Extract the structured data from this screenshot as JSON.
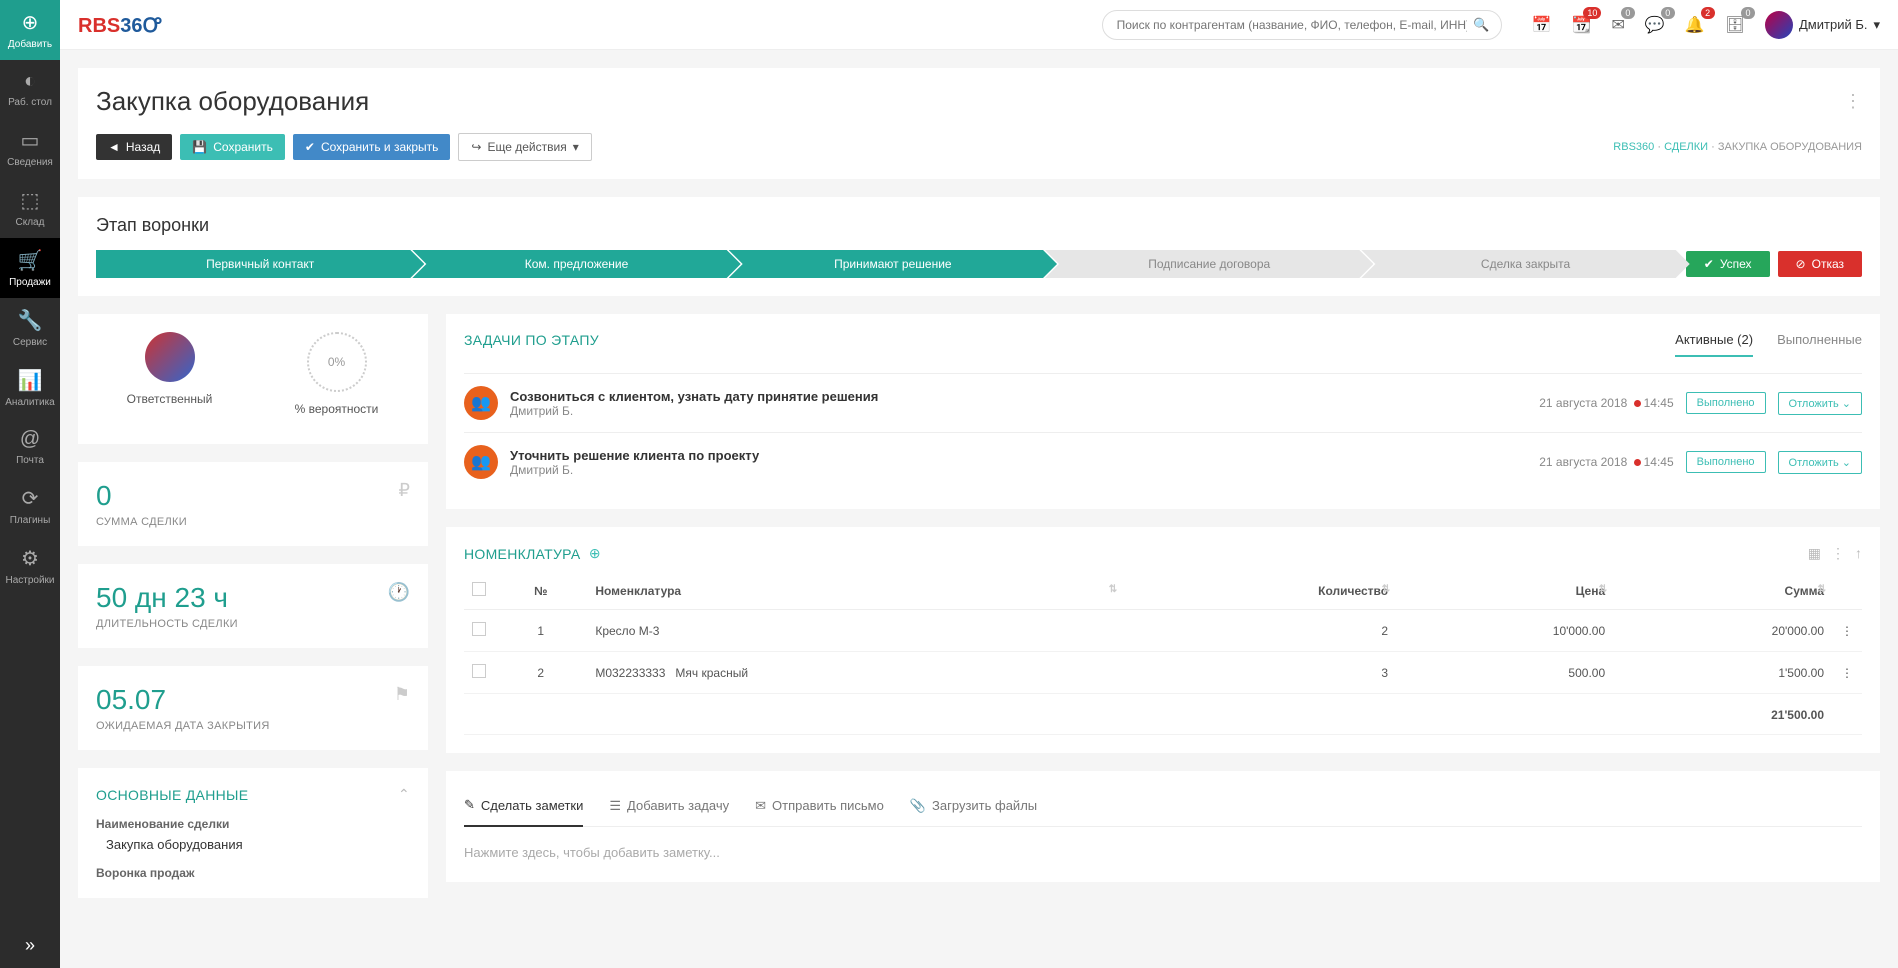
{
  "sidebar": {
    "items": [
      {
        "label": "Добавить",
        "icon": "⊕"
      },
      {
        "label": "Раб. стол",
        "icon": "◐"
      },
      {
        "label": "Сведения",
        "icon": "▭"
      },
      {
        "label": "Склад",
        "icon": "⬚"
      },
      {
        "label": "Продажи",
        "icon": "🛒"
      },
      {
        "label": "Сервис",
        "icon": "🔧"
      },
      {
        "label": "Аналитика",
        "icon": "📊"
      },
      {
        "label": "Почта",
        "icon": "@"
      },
      {
        "label": "Плагины",
        "icon": "⟳"
      },
      {
        "label": "Настройки",
        "icon": "⚙"
      }
    ]
  },
  "topbar": {
    "search_placeholder": "Поиск по контрагентам (название, ФИО, телефон, E-mail, ИНН)...",
    "badges": {
      "cal2": "10",
      "env": "0",
      "chat": "0",
      "bell": "2",
      "drawer": "0"
    },
    "user_name": "Дмитрий Б."
  },
  "page": {
    "title": "Закупка оборудования",
    "back": "Назад",
    "save": "Сохранить",
    "save_close": "Сохранить и закрыть",
    "more": "Еще действия"
  },
  "breadcrumb": {
    "a": "RBS360",
    "b": "СДЕЛКИ",
    "c": "ЗАКУПКА ОБОРУДОВАНИЯ"
  },
  "funnel": {
    "title": "Этап воронки",
    "stages": [
      "Первичный контакт",
      "Ком. предложение",
      "Принимают решение",
      "Подписание договора",
      "Сделка закрыта"
    ],
    "success": "Успех",
    "fail": "Отказ"
  },
  "owner": {
    "label": "Ответственный",
    "prob_label": "% вероятности",
    "prob_val": "0%"
  },
  "stats": {
    "sum_val": "0",
    "sum_label": "СУММА СДЕЛКИ",
    "dur_val": "50 дн 23 ч",
    "dur_label": "ДЛИТЕЛЬНОСТЬ СДЕЛКИ",
    "date_val": "05.07",
    "date_label": "ОЖИДАЕМАЯ ДАТА ЗАКРЫТИЯ"
  },
  "basic": {
    "title": "ОСНОВНЫЕ ДАННЫЕ",
    "name_label": "Наименование сделки",
    "name_val": "Закупка оборудования",
    "funnel_label": "Воронка продаж"
  },
  "tasks": {
    "title": "ЗАДАЧИ ПО ЭТАПУ",
    "tab_active": "Активные (2)",
    "tab_done": "Выполненные",
    "btn_done": "Выполнено",
    "btn_delay": "Отложить",
    "items": [
      {
        "title": "Созвониться с клиентом, узнать дату принятие решения",
        "owner": "Дмитрий Б.",
        "date": "21 августа 2018",
        "time": "14:45"
      },
      {
        "title": "Уточнить решение клиента по проекту",
        "owner": "Дмитрий Б.",
        "date": "21 августа 2018",
        "time": "14:45"
      }
    ]
  },
  "nom": {
    "title": "НОМЕНКЛАТУРА",
    "cols": {
      "num": "№",
      "name": "Номенклатура",
      "qty": "Количество",
      "price": "Цена",
      "sum": "Сумма"
    },
    "rows": [
      {
        "n": "1",
        "code": "",
        "name": "Кресло М-3",
        "qty": "2",
        "price": "10'000.00",
        "sum": "20'000.00"
      },
      {
        "n": "2",
        "code": "М032233333",
        "name": "Мяч красный",
        "qty": "3",
        "price": "500.00",
        "sum": "1'500.00"
      }
    ],
    "total": "21'500.00"
  },
  "notes": {
    "tab_note": "Сделать заметки",
    "tab_task": "Добавить задачу",
    "tab_mail": "Отправить письмо",
    "tab_file": "Загрузить файлы",
    "placeholder": "Нажмите здесь, чтобы добавить заметку..."
  }
}
